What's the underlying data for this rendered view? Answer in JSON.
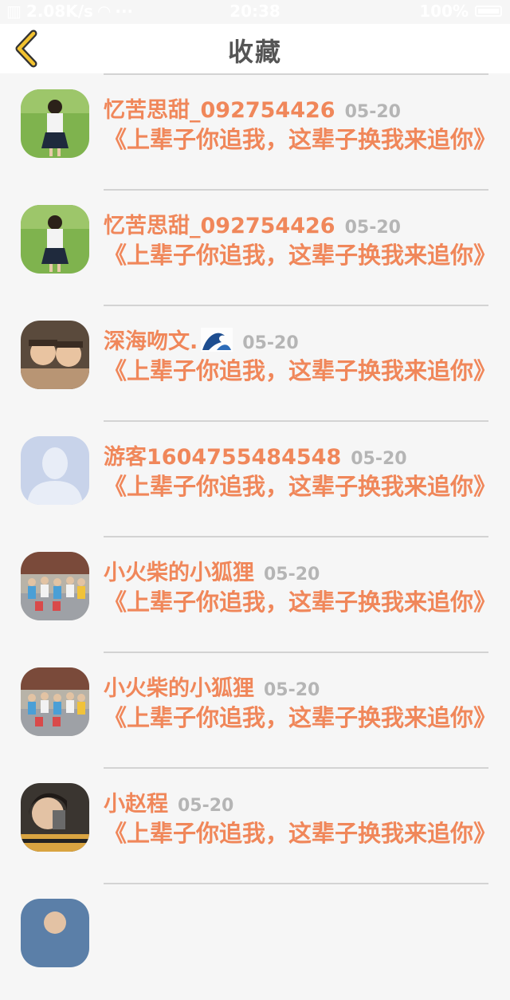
{
  "status_bar": {
    "network_speed": "2.08K/s",
    "time": "20:38",
    "battery": "100%"
  },
  "nav": {
    "title": "收藏",
    "back_icon": "chevron-left-icon",
    "accent_color": "#f2c230"
  },
  "items": [
    {
      "username": "忆苦思甜_092754426",
      "date": "05-20",
      "message": "《上辈子你追我，这辈子换我来追你》"
    },
    {
      "username": "忆苦思甜_092754426",
      "date": "05-20",
      "message": "《上辈子你追我，这辈子换我来追你》"
    },
    {
      "username": "深海吻文.",
      "date": "05-20",
      "message": "《上辈子你追我，这辈子换我来追你》"
    },
    {
      "username": "游客1604755484548",
      "date": "05-20",
      "message": "《上辈子你追我，这辈子换我来追你》"
    },
    {
      "username": "小火柴的小狐狸",
      "date": "05-20",
      "message": "《上辈子你追我，这辈子换我来追你》"
    },
    {
      "username": "小火柴的小狐狸",
      "date": "05-20",
      "message": "《上辈子你追我，这辈子换我来追你》"
    },
    {
      "username": "小赵程",
      "date": "05-20",
      "message": "《上辈子你追我，这辈子换我来追你》"
    }
  ],
  "colors": {
    "username": "#f0875a",
    "date": "#b5b5b5",
    "divider": "#d3d3d3"
  }
}
